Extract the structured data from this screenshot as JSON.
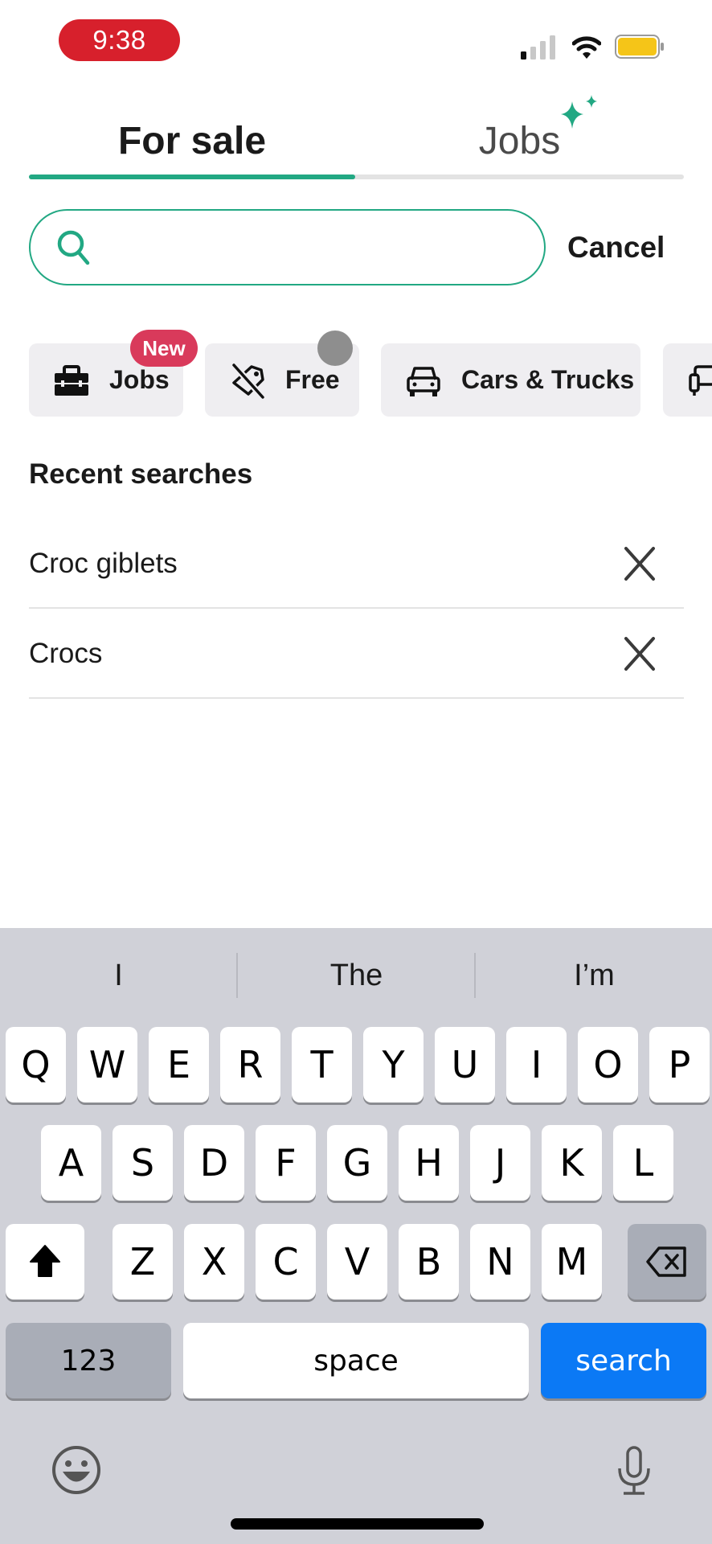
{
  "status_bar": {
    "time": "9:38",
    "signal_icon": "cellular-signal-icon",
    "wifi_icon": "wifi-icon",
    "battery_icon": "battery-icon",
    "battery_color": "#f5c518"
  },
  "tabs": {
    "items": [
      {
        "label": "For sale",
        "active": true
      },
      {
        "label": "Jobs",
        "active": false,
        "decoration": "sparkle-icon"
      }
    ],
    "accent_color": "#22a883"
  },
  "search": {
    "value": "",
    "placeholder": "",
    "icon": "search-icon",
    "cancel_label": "Cancel"
  },
  "chips": [
    {
      "label": "Jobs",
      "icon": "briefcase-icon",
      "badge": "New"
    },
    {
      "label": "Free",
      "icon": "free-tag-icon"
    },
    {
      "label": "Cars & Trucks",
      "icon": "car-icon"
    },
    {
      "label": "",
      "icon": "sofa-icon"
    }
  ],
  "recent": {
    "title": "Recent searches",
    "items": [
      {
        "label": "Croc giblets"
      },
      {
        "label": "Crocs"
      }
    ]
  },
  "keyboard": {
    "suggestions": [
      "I",
      "The",
      "I’m"
    ],
    "row1": [
      "Q",
      "W",
      "E",
      "R",
      "T",
      "Y",
      "U",
      "I",
      "O",
      "P"
    ],
    "row2": [
      "A",
      "S",
      "D",
      "F",
      "G",
      "H",
      "J",
      "K",
      "L"
    ],
    "row3": [
      "Z",
      "X",
      "C",
      "V",
      "B",
      "N",
      "M"
    ],
    "numbers_label": "123",
    "space_label": "space",
    "search_label": "search",
    "return_color": "#0b79f5"
  }
}
